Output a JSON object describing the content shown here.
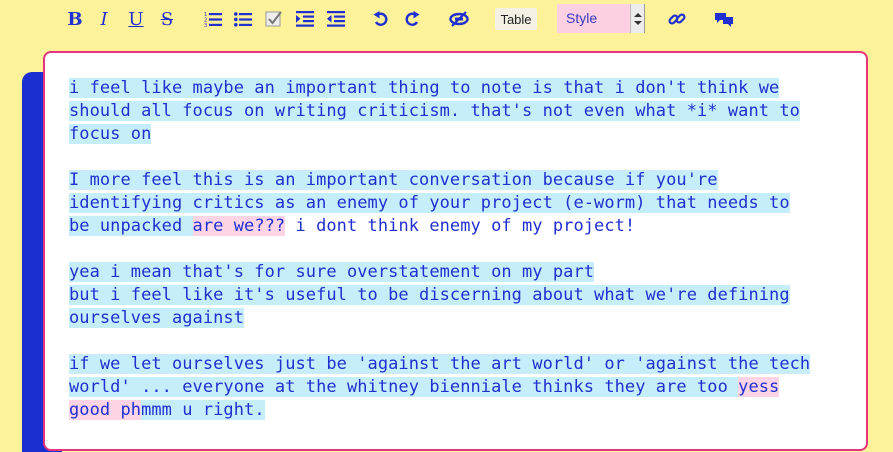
{
  "toolbar": {
    "bold": "B",
    "italic": "I",
    "underline": "U",
    "strikethrough": "S",
    "table_label": "Table",
    "style_select_value": "Style",
    "accent_color": "#1f2fd0",
    "icons": [
      "bold-icon",
      "italic-icon",
      "underline-icon",
      "strikethrough-icon",
      "ordered-list-icon",
      "bullet-list-icon",
      "checklist-icon",
      "indent-icon",
      "outdent-icon",
      "undo-icon",
      "redo-icon",
      "unlink-icon",
      "link-icon",
      "comment-icon"
    ]
  },
  "editor": {
    "border_color": "#e8337e",
    "highlight_color": "#c6eefa",
    "pink_highlight_color": "#fcd4e6",
    "paragraphs": [
      {
        "lines": [
          "i feel like maybe an important thing to note is that i don't think we",
          "should all focus on writing criticism. that's not even what *i* want to",
          "focus on"
        ]
      },
      {
        "line1": "I more feel this is an important conversation because if you're",
        "line2": "identifying critics as an enemy of your project (e-worm) that needs to",
        "line3_a": "be unpacked ",
        "line3_pink": "are we???",
        "line3_b": " i dont think enemy of my project!"
      },
      {
        "lines": [
          "yea i mean that's for sure overstatement on my part",
          "but i feel like it's useful to be discerning about what we're defining",
          "ourselves against"
        ]
      },
      {
        "line1": "if we let ourselves just be 'against the art world' or 'against the tech",
        "line2_a": "world' ... everyone at the whitney bienniale thinks they are too ",
        "line2_pink": "yess",
        "line3_pink": "good ph",
        "line3_b": "mmm u right."
      }
    ]
  }
}
